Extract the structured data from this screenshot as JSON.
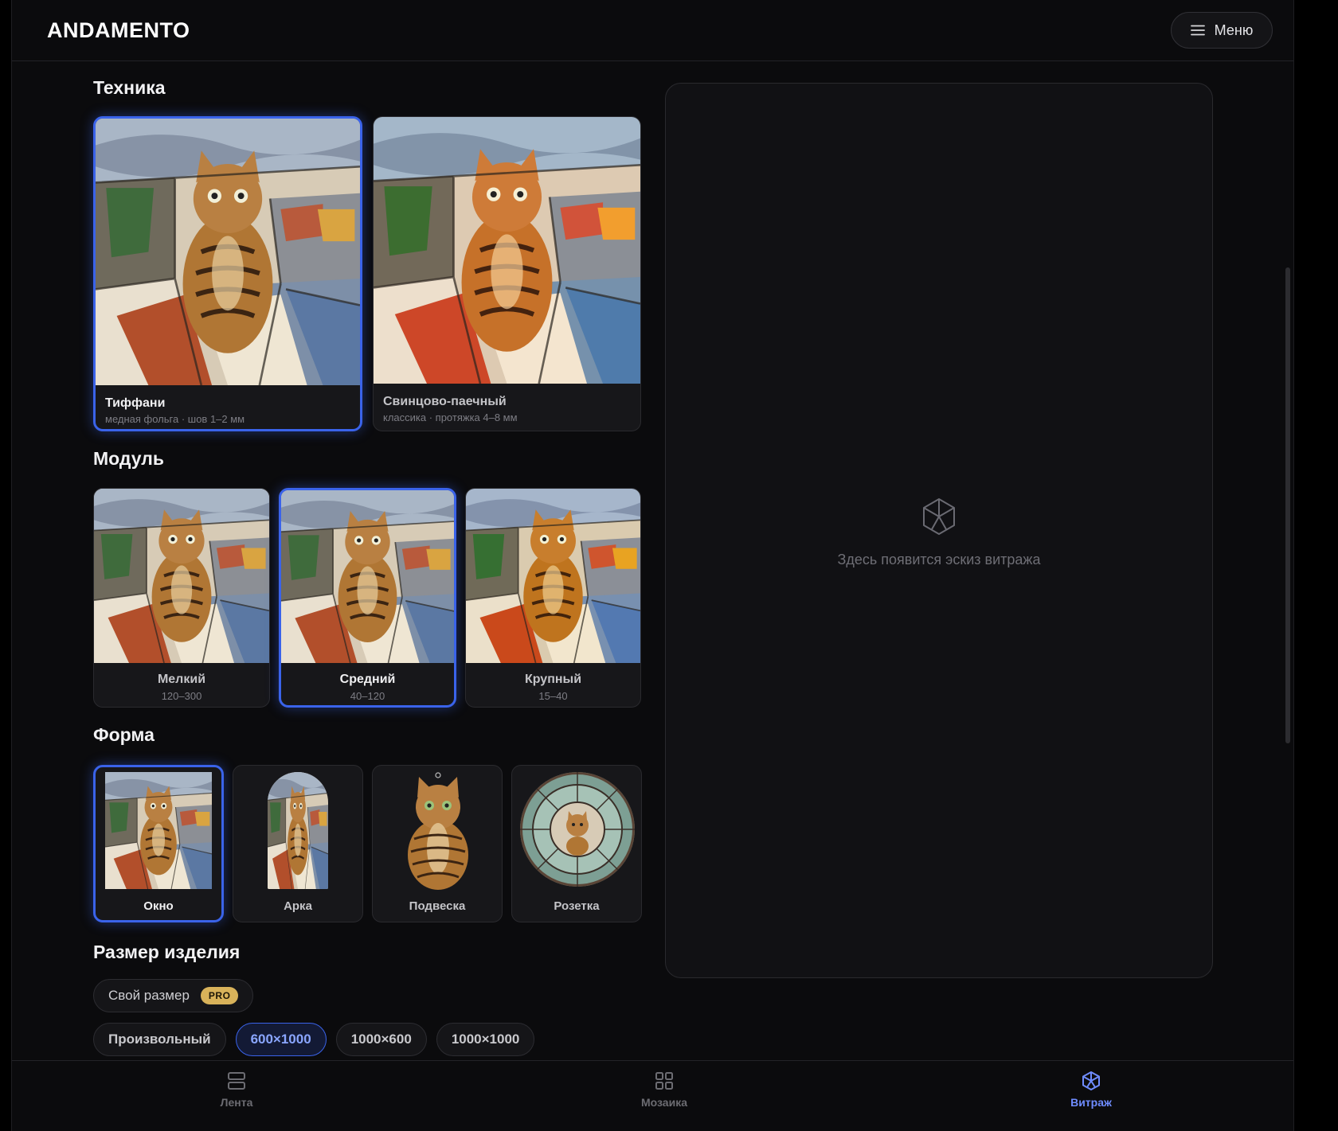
{
  "app": {
    "logo": "ANDAMENTO",
    "menu_label": "Меню"
  },
  "technique": {
    "title": "Техника",
    "options": [
      {
        "label": "Тиффани",
        "sub": "медная фольга · шов 1–2 мм",
        "selected": true
      },
      {
        "label": "Свинцово-паечный",
        "sub": "классика · протяжка 4–8 мм",
        "selected": false
      }
    ]
  },
  "module": {
    "title": "Модуль",
    "options": [
      {
        "label": "Мелкий",
        "sub": "120–300",
        "selected": false
      },
      {
        "label": "Средний",
        "sub": "40–120",
        "selected": true
      },
      {
        "label": "Крупный",
        "sub": "15–40",
        "selected": false
      }
    ]
  },
  "shape": {
    "title": "Форма",
    "options": [
      {
        "label": "Окно",
        "selected": true
      },
      {
        "label": "Арка",
        "selected": false
      },
      {
        "label": "Подвеска",
        "selected": false
      },
      {
        "label": "Розетка",
        "selected": false
      }
    ]
  },
  "size": {
    "title": "Размер изделия",
    "custom_label": "Свой размер",
    "pro_badge": "PRO",
    "presets": [
      "Произвольный",
      "600×1000",
      "1000×600",
      "1000×1000"
    ],
    "active_preset": "600×1000"
  },
  "preview": {
    "hint": "Здесь появится эскиз витража"
  },
  "nav": {
    "tabs": [
      {
        "label": "Лента",
        "icon": "feed-icon",
        "active": false
      },
      {
        "label": "Мозаика",
        "icon": "grid-icon",
        "active": false
      },
      {
        "label": "Витраж",
        "icon": "stained-glass-icon",
        "active": true
      }
    ]
  },
  "colors": {
    "accent": "#3a63ea",
    "active_text": "#8aa6ff",
    "pro_badge": "#d8b25a",
    "background": "#0b0b0d"
  }
}
